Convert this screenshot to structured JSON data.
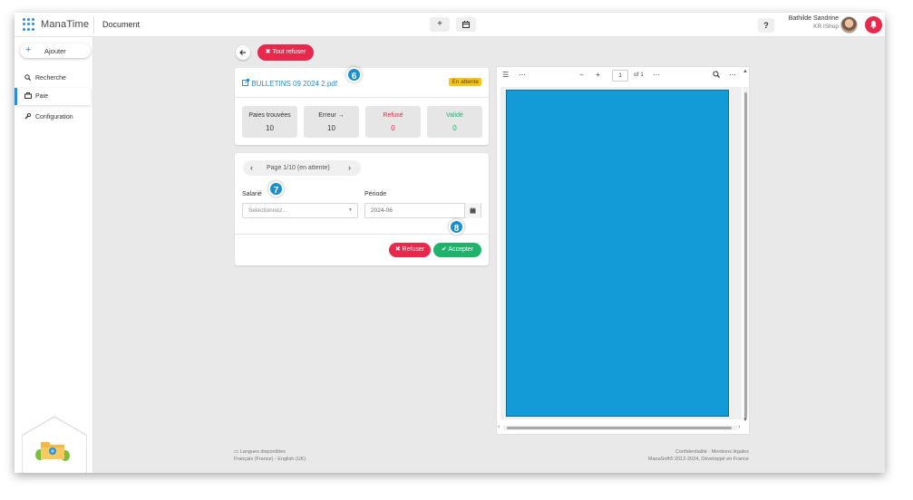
{
  "app": {
    "brand": "ManaTime",
    "page_title": "Document"
  },
  "topbar": {
    "add_icon": "+",
    "calendar_icon": "calendar",
    "help": "?",
    "user_name": "Bathilde Sandrine",
    "user_org": "KR IShop"
  },
  "sidebar": {
    "add_label": "Ajouter",
    "items": [
      {
        "label": "Recherche",
        "icon": "search-icon"
      },
      {
        "label": "Paie",
        "icon": "briefcase-icon"
      },
      {
        "label": "Configuration",
        "icon": "wrench-icon"
      }
    ]
  },
  "toolbar": {
    "refuse_all": "Tout refuser"
  },
  "document": {
    "file_name": "BULLETINS 09 2024 2.pdf",
    "status": "En attente",
    "stats": [
      {
        "title": "Paies trouvées",
        "value": "10",
        "color": "#333333"
      },
      {
        "title": "Erreur →",
        "value": "10",
        "color": "#333333"
      },
      {
        "title": "Refusé",
        "value": "0",
        "color": "#e8294b"
      },
      {
        "title": "Validé",
        "value": "0",
        "color": "#1fb26b"
      }
    ]
  },
  "form": {
    "pager": "Page 1/10 (en attente)",
    "salarie_label": "Salarié",
    "salarie_placeholder": "Selectionnez...",
    "periode_label": "Période",
    "periode_value": "2024-06",
    "refuse": "Refuser",
    "accept": "Accepter"
  },
  "callouts": [
    "6",
    "7",
    "8"
  ],
  "viewer": {
    "page_value": "1",
    "page_total": "of 1",
    "doc_color": "#129bd6"
  },
  "footer": {
    "lang_title": "Langues disponibles",
    "lang_list": "Français (France) - English (UK)",
    "legal": "Confidentialité - Mentions légales",
    "copyright": "ManaSoft® 2012-2024, Développé en France"
  }
}
